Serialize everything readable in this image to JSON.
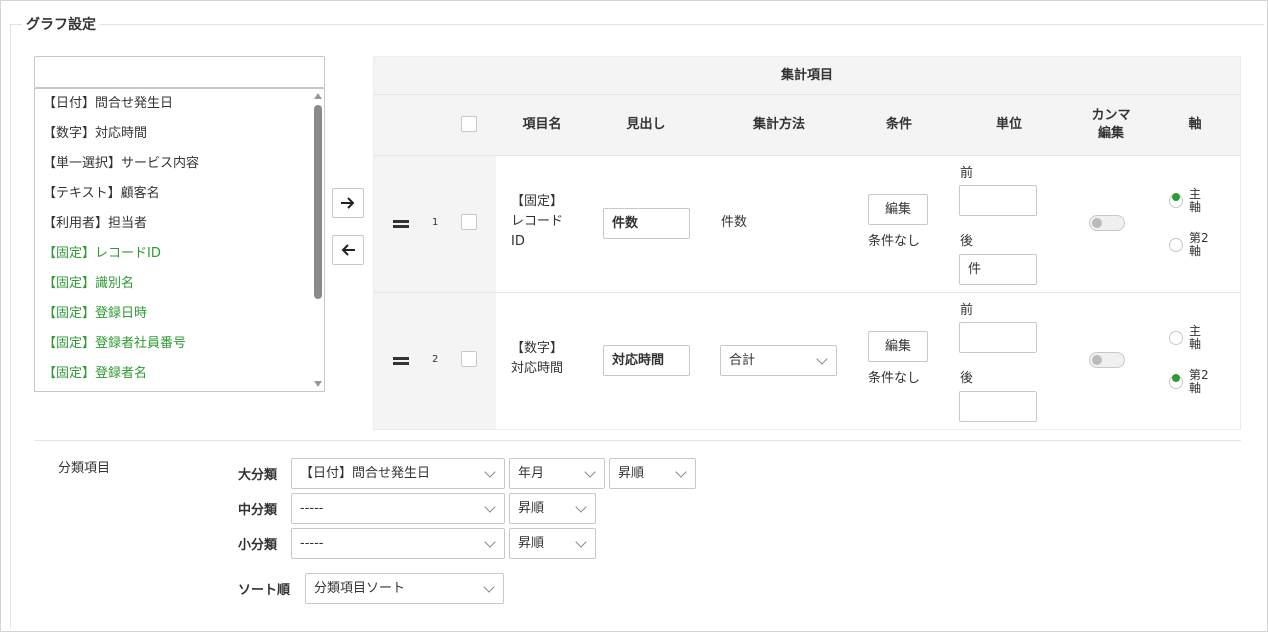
{
  "section_title": "グラフ設定",
  "search": {
    "value": ""
  },
  "field_list": [
    {
      "label": "【日付】問合せ発生日",
      "color": "#333333"
    },
    {
      "label": "【数字】対応時間",
      "color": "#333333"
    },
    {
      "label": "【単一選択】サービス内容",
      "color": "#333333"
    },
    {
      "label": "【テキスト】顧客名",
      "color": "#333333"
    },
    {
      "label": "【利用者】担当者",
      "color": "#333333"
    },
    {
      "label": "【固定】レコードID",
      "color": "#2e9a35"
    },
    {
      "label": "【固定】識別名",
      "color": "#2e9a35"
    },
    {
      "label": "【固定】登録日時",
      "color": "#2e9a35"
    },
    {
      "label": "【固定】登録者社員番号",
      "color": "#2e9a35"
    },
    {
      "label": "【固定】登録者名",
      "color": "#2e9a35"
    }
  ],
  "move_right_icon": "arrow-right-icon",
  "move_left_icon": "arrow-left-icon",
  "table": {
    "title": "集計項目",
    "headers": {
      "name": "項目名",
      "heading": "見出し",
      "method": "集計方法",
      "condition": "条件",
      "unit": "単位",
      "comma_1": "カンマ",
      "comma_2": "編集",
      "axis": "軸"
    },
    "rows": [
      {
        "num": "1",
        "name_1": "【固定】",
        "name_2": "レコード",
        "name_3": "ID",
        "heading": "件数",
        "method_text": "件数",
        "edit_label": "編集",
        "condition": "条件なし",
        "unit_before_label": "前",
        "unit_before": "",
        "unit_after_label": "後",
        "unit_after": "件",
        "axis_primary_1": "主",
        "axis_primary_2": "軸",
        "axis_secondary_1": "第2",
        "axis_secondary_2": "軸",
        "axis_selected": "primary"
      },
      {
        "num": "2",
        "name_1": "【数字】",
        "name_2": "対応時間",
        "heading": "対応時間",
        "method_select": "合計",
        "edit_label": "編集",
        "condition": "条件なし",
        "unit_before_label": "前",
        "unit_before": "",
        "unit_after_label": "後",
        "unit_after": "",
        "axis_primary_1": "主",
        "axis_primary_2": "軸",
        "axis_secondary_1": "第2",
        "axis_secondary_2": "軸",
        "axis_selected": "secondary"
      }
    ]
  },
  "classification": {
    "title": "分類項目",
    "major_label": "大分類",
    "major_field": "【日付】問合せ発生日",
    "major_unit": "年月",
    "major_order": "昇順",
    "middle_label": "中分類",
    "middle_field": "-----",
    "middle_order": "昇順",
    "minor_label": "小分類",
    "minor_field": "-----",
    "minor_order": "昇順",
    "sort_label": "ソート順",
    "sort_value": "分類項目ソート"
  }
}
